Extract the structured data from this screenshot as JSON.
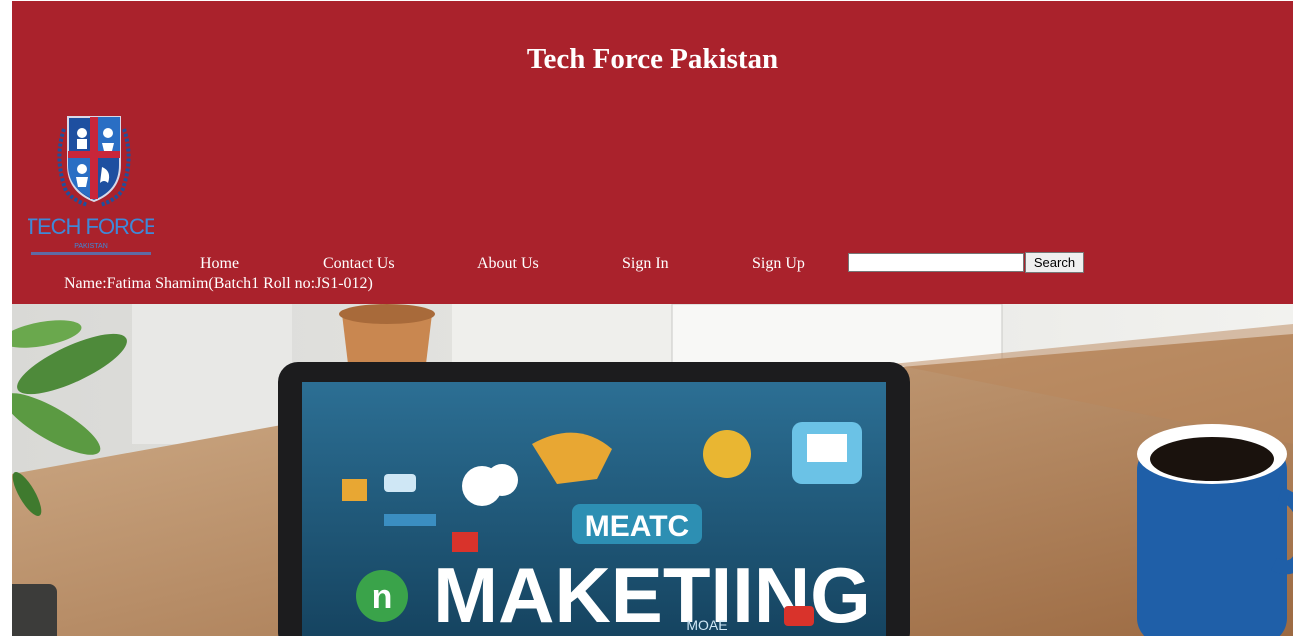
{
  "header": {
    "title": "Tech Force Pakistan",
    "background_color": "#aa222c",
    "text_color": "#ffffff",
    "logo": {
      "icon": "tech-force-shield-logo",
      "wordmark": "TECH FORCE",
      "sub_wordmark": "PAKISTAN"
    }
  },
  "nav": {
    "items": [
      {
        "label": "Home"
      },
      {
        "label": "Contact Us"
      },
      {
        "label": "About Us"
      },
      {
        "label": "Sign In"
      },
      {
        "label": "Sign Up"
      }
    ],
    "search": {
      "value": "",
      "placeholder": "",
      "button_label": "Search"
    }
  },
  "student_info": "Name:Fatima Shamim(Batch1 Roll no:JS1-012)",
  "hero": {
    "icon": "laptop-marketing-photo",
    "screen_heading": "MEATC",
    "screen_title": "MAKETIING",
    "screen_footer": "MOAE"
  }
}
